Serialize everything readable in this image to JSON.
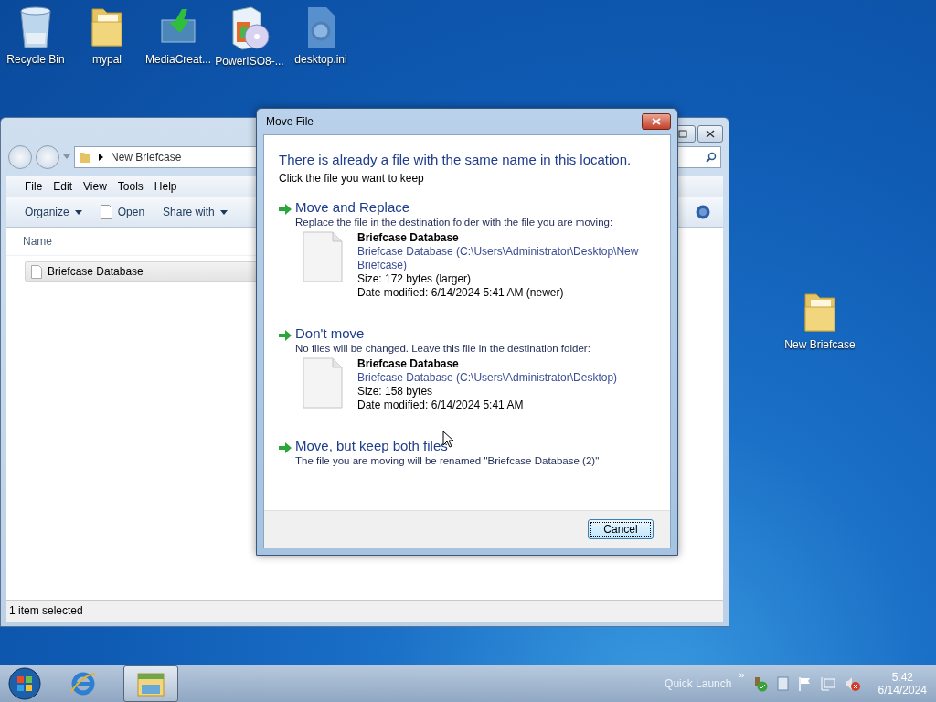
{
  "desktop": {
    "icons": [
      {
        "kind": "recycle",
        "label": "Recycle Bin"
      },
      {
        "kind": "folder",
        "label": "mypal"
      },
      {
        "kind": "media",
        "label": "MediaCreat..."
      },
      {
        "kind": "disc",
        "label": "PowerISO8-..."
      },
      {
        "kind": "settings",
        "label": "desktop.ini"
      }
    ],
    "side_icons": [
      {
        "kind": "folder",
        "label": "New Briefcase"
      }
    ]
  },
  "explorer": {
    "address": "New Briefcase",
    "menu": [
      "File",
      "Edit",
      "View",
      "Tools",
      "Help"
    ],
    "toolbar": [
      {
        "kind": "dropdown",
        "label": "Organize"
      },
      {
        "kind": "open",
        "label": "Open"
      },
      {
        "kind": "dropdown",
        "label": "Share with"
      }
    ],
    "column": "Name",
    "files": [
      {
        "name": "Briefcase Database",
        "selected": true
      }
    ],
    "status": "1 item selected"
  },
  "dialog": {
    "title": "Move File",
    "heading": "There is already a file with the same name in this location.",
    "subheading": "Click the file you want to keep",
    "options": [
      {
        "title": "Move and Replace",
        "description": "Replace the file in the destination folder with the file you are moving:",
        "file": {
          "name": "Briefcase Database",
          "path": "Briefcase Database (C:\\Users\\Administrator\\Desktop\\New Briefcase)",
          "size": "Size: 172 bytes (larger)",
          "date": "Date modified: 6/14/2024 5:41 AM (newer)"
        }
      },
      {
        "title": "Don't move",
        "description": "No files will be changed. Leave this file in the destination folder:",
        "file": {
          "name": "Briefcase Database",
          "path": "Briefcase Database (C:\\Users\\Administrator\\Desktop)",
          "size": "Size: 158 bytes",
          "date": "Date modified: 6/14/2024 5:41 AM"
        }
      },
      {
        "title": "Move, but keep both files",
        "description": "The file you are moving will be renamed \"Briefcase Database (2)\""
      }
    ],
    "buttons": [
      {
        "label": "Cancel",
        "focused": true
      }
    ]
  },
  "taskbar": {
    "items": [
      {
        "kind": "browser",
        "selected": false
      },
      {
        "kind": "explorer",
        "selected": true
      }
    ],
    "quick_launch": "Quick Launch",
    "overflow": "»",
    "time": "5:42",
    "date": "6/14/2024"
  }
}
